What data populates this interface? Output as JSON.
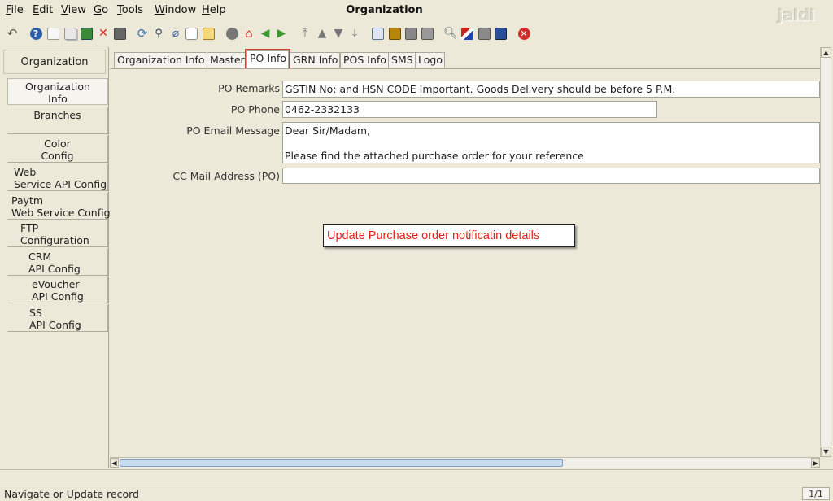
{
  "window": {
    "title": "Organization",
    "brand": "jaldi"
  },
  "menubar": [
    "File",
    "Edit",
    "View",
    "Go",
    "Tools",
    "Window",
    "Help"
  ],
  "toolbar": [
    "undo-icon",
    "help-icon",
    "new-record-icon",
    "copy-record-icon",
    "save-icon",
    "delete-icon",
    "save-disk-icon",
    "refresh-icon",
    "find-icon",
    "attachment-icon",
    "chat-icon",
    "history-icon",
    "report-icon",
    "home-icon",
    "back-arrow-icon",
    "forward-arrow-icon",
    "first-record-icon",
    "previous-record-icon",
    "next-record-icon",
    "last-record-icon",
    "print-preview-icon",
    "archive-icon",
    "print-icon",
    "printer-icon",
    "zoom-icon",
    "workflow-icon",
    "process-icon",
    "product-icon",
    "close-icon"
  ],
  "leftnav": {
    "header": "Organization",
    "items": [
      "Organization\nInfo",
      "Branches",
      "Color\nConfig",
      "Web\nService API Config",
      "Paytm\nWeb Service Config",
      "FTP\nConfiguration",
      "CRM\nAPI Config",
      "eVoucher\nAPI Config",
      "SS\nAPI Config"
    ]
  },
  "tabs": [
    "Organization Info",
    "Master",
    "PO Info",
    "GRN Info",
    "POS Info",
    "SMS",
    "Logo"
  ],
  "form": {
    "po_remarks_label": "PO Remarks",
    "po_remarks_value": "GSTIN No: and HSN CODE Important. Goods Delivery should be before 5 P.M.",
    "po_phone_label": "PO Phone",
    "po_phone_value": "0462-2332133",
    "po_email_label": "PO Email Message",
    "po_email_value": "Dear Sir/Madam,\n\nPlease find the attached purchase order for your reference",
    "cc_mail_label": "CC Mail Address (PO)",
    "cc_mail_value": ""
  },
  "callout": "Update Purchase order notificatin details",
  "status": {
    "message": "Navigate or Update record",
    "record": "1/1"
  },
  "colors": {
    "callout_text": "#e8201a",
    "active_tab_outline": "#d0403a",
    "scroll_thumb": "#c8dcf0"
  }
}
